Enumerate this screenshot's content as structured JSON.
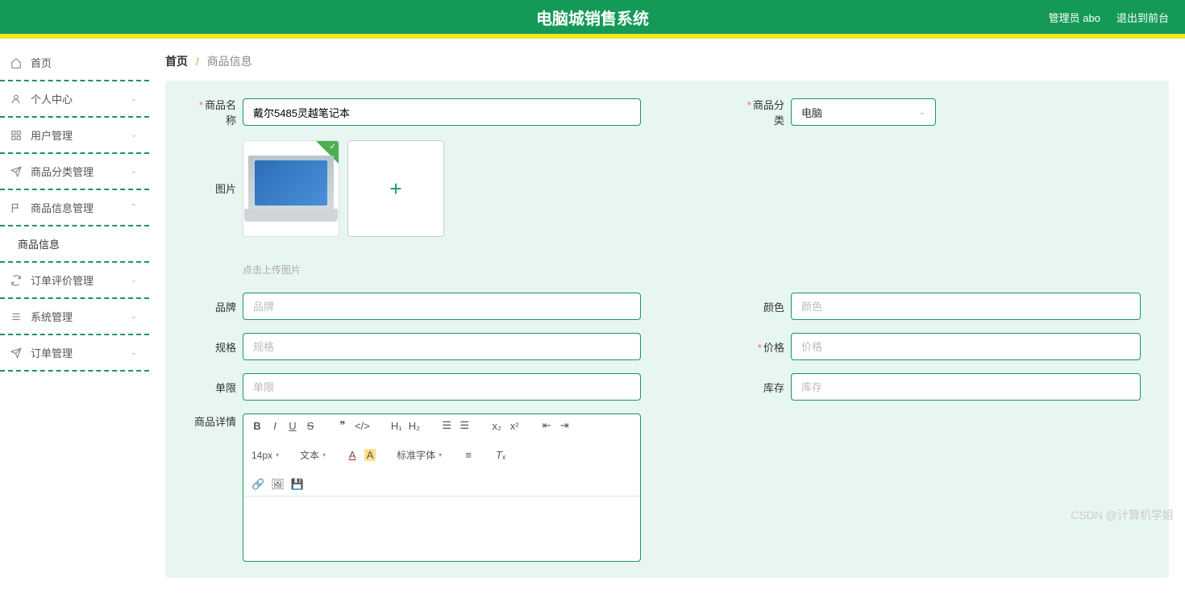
{
  "header": {
    "title": "电脑城销售系统",
    "admin_label": "管理员 abo",
    "logout_label": "退出到前台"
  },
  "sidebar": {
    "items": [
      {
        "icon": "home-icon",
        "label": "首页",
        "expandable": false
      },
      {
        "icon": "user-icon",
        "label": "个人中心",
        "expandable": true,
        "arrow": "v"
      },
      {
        "icon": "grid-icon",
        "label": "用户管理",
        "expandable": true,
        "arrow": "v"
      },
      {
        "icon": "send-icon",
        "label": "商品分类管理",
        "expandable": true,
        "arrow": "v"
      },
      {
        "icon": "flag-icon",
        "label": "商品信息管理",
        "expandable": true,
        "arrow": "^",
        "open": true,
        "children": [
          {
            "label": "商品信息"
          }
        ]
      },
      {
        "icon": "refresh-icon",
        "label": "订单评价管理",
        "expandable": true,
        "arrow": "v"
      },
      {
        "icon": "list-icon",
        "label": "系统管理",
        "expandable": true,
        "arrow": "v"
      },
      {
        "icon": "send-icon",
        "label": "订单管理",
        "expandable": true,
        "arrow": "v"
      }
    ]
  },
  "breadcrumb": {
    "home": "首页",
    "current": "商品信息"
  },
  "form": {
    "product_name": {
      "label": "商品名称",
      "value": "戴尔5485灵越笔记本",
      "required": true
    },
    "category": {
      "label": "商品分类",
      "value": "电脑",
      "required": true
    },
    "image": {
      "label": "图片",
      "hint": "点击上传图片"
    },
    "brand": {
      "label": "品牌",
      "placeholder": "品牌"
    },
    "color": {
      "label": "颜色",
      "placeholder": "颜色"
    },
    "spec": {
      "label": "规格",
      "placeholder": "规格"
    },
    "price": {
      "label": "价格",
      "placeholder": "价格",
      "required": true
    },
    "limit": {
      "label": "单限",
      "placeholder": "单限"
    },
    "stock": {
      "label": "库存",
      "placeholder": "库存"
    },
    "detail": {
      "label": "商品详情"
    }
  },
  "editor_toolbar": {
    "fontsize": "14px",
    "block": "文本",
    "fontfamily": "标准字体"
  },
  "watermark": "CSDN @计算机学姐"
}
